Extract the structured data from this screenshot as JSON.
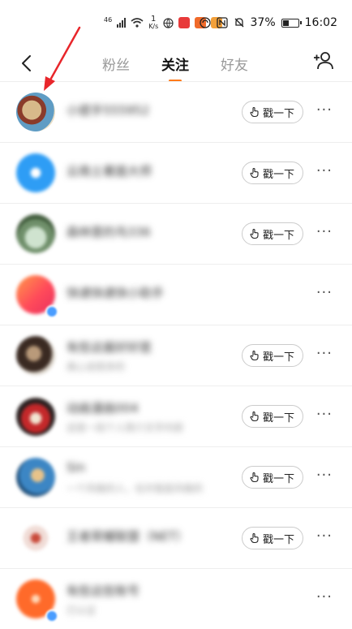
{
  "status": {
    "network": "46",
    "speed_top": "1",
    "speed_unit": "K/s",
    "battery": "37%",
    "time": "16:02"
  },
  "tabs": [
    {
      "label": "粉丝"
    },
    {
      "label": "关注"
    },
    {
      "label": "好友"
    }
  ],
  "active_tab": "关注",
  "poke_label": "戳一下",
  "more_label": "···",
  "follows": [
    {
      "name": "小提手555952",
      "sub": "",
      "poke": true
    },
    {
      "name": "云南土著面大师",
      "sub": "",
      "poke": true
    },
    {
      "name": "森林里的鸟336",
      "sub": "",
      "poke": true
    },
    {
      "name": "快递快递快小助手",
      "sub": "",
      "poke": false
    },
    {
      "name": "有些这酱好好是",
      "sub": "真心说很多的",
      "poke": true
    },
    {
      "name": "动画漫画004",
      "sub": "这是一段个人简介文字内容",
      "poke": true
    },
    {
      "name": "Sin",
      "sub": "一个风格的人，也许我是风格的",
      "poke": true
    },
    {
      "name": "王者荣耀联盟（NET）",
      "sub": "",
      "poke": true
    },
    {
      "name": "有些这些账号",
      "sub": "已认证",
      "poke": false
    }
  ],
  "colors": {
    "accent": "#ff7a1a",
    "annotation": "#e8262b"
  }
}
